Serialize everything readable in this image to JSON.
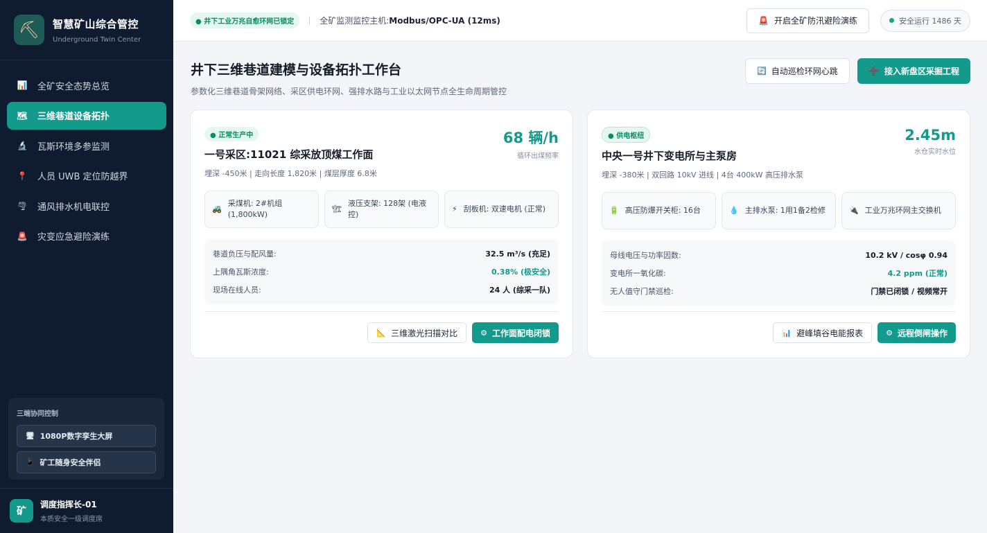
{
  "brand": {
    "title": "智慧矿山综合管控",
    "subtitle": "Underground Twin Center",
    "logo_icon": "⛏"
  },
  "nav": [
    {
      "icon": "📊",
      "icon_name": "chart-icon",
      "label": "全矿安全态势总览",
      "active": false
    },
    {
      "icon": "🗺",
      "icon_name": "map-icon",
      "label": "三维巷道设备拓扑",
      "active": true
    },
    {
      "icon": "🔬",
      "icon_name": "microscope-icon",
      "label": "瓦斯环境多参监测",
      "active": false
    },
    {
      "icon": "📍",
      "icon_name": "pin-icon",
      "label": "人员 UWB 定位防越界",
      "active": false
    },
    {
      "icon": "🌪",
      "icon_name": "ventilation-icon",
      "label": "通风排水机电联控",
      "active": false
    },
    {
      "icon": "🚨",
      "icon_name": "alarm-icon",
      "label": "灾变应急避险演练",
      "active": false
    }
  ],
  "sync": {
    "title": "三端协同控制",
    "buttons": [
      {
        "icon": "🖥",
        "label": "1080P数字孪生大屏"
      },
      {
        "icon": "📱",
        "label": "矿工随身安全伴侣"
      }
    ]
  },
  "user": {
    "avatar": "矿",
    "name": "调度指挥长-01",
    "role": "本质安全一级调度席"
  },
  "topbar": {
    "net_badge": "● 井下工业万兆自愈环网已锁定",
    "monitor_prefix": "全矿监测监控主机:",
    "monitor_value": "Modbus/OPC-UA (12ms)",
    "drill_icon": "🚨",
    "drill_label": "开启全矿防汛避险演练",
    "safe_label": "安全运行 1486 天"
  },
  "header": {
    "title": "井下三维巷道建模与设备拓扑工作台",
    "subtitle": "参数化三维巷道骨架网络、采区供电环网、强排水路与工业以太网节点全生命周期管控",
    "btn_heartbeat": "自动巡检环网心跳",
    "btn_heartbeat_icon": "🔄",
    "btn_add": "接入新盘区采掘工程",
    "btn_add_icon": "➕"
  },
  "cards": [
    {
      "badge": "● 正常生产中",
      "title": "一号采区:11021 综采放顶煤工作面",
      "meta": "埋深 -450米 | 走向长度 1,820米 | 煤层厚度 6.8米",
      "metric_value": "68 辆/h",
      "metric_label": "循环出煤频率",
      "equipment": [
        {
          "icon": "🚜",
          "text": "采煤机: 2#机组 (1,800kW)"
        },
        {
          "icon": "🏗",
          "text": "液压支架: 128架 (电液控)"
        },
        {
          "icon": "⚡",
          "text": "刮板机: 双速电机 (正常)"
        }
      ],
      "stats": [
        {
          "k": "巷道负压与配风量:",
          "v": "32.5 m³/s (充足)",
          "good": false
        },
        {
          "k": "上隅角瓦斯浓度:",
          "v": "0.38% (极安全)",
          "good": true
        },
        {
          "k": "现场在线人员:",
          "v": "24 人 (综采一队)",
          "good": false
        }
      ],
      "foot_outline": "三维激光扫描对比",
      "foot_outline_icon": "📐",
      "foot_primary": "工作面配电闭锁",
      "foot_primary_icon": "⚙"
    },
    {
      "badge": "● 供电枢纽",
      "title": "中央一号井下变电所与主泵房",
      "meta": "埋深 -380米 | 双回路 10kV 进线 | 4台 400kW 高压排水泵",
      "metric_value": "2.45m",
      "metric_label": "水仓实时水位",
      "equipment": [
        {
          "icon": "🔋",
          "text": "高压防爆开关柜: 16台"
        },
        {
          "icon": "💧",
          "text": "主排水泵: 1用1备2检修"
        },
        {
          "icon": "🔌",
          "text": "工业万兆环网主交换机"
        }
      ],
      "stats": [
        {
          "k": "母线电压与功率因数:",
          "v": "10.2 kV / cosφ 0.94",
          "good": false
        },
        {
          "k": "变电所一氧化碳:",
          "v": "4.2 ppm (正常)",
          "good": true
        },
        {
          "k": "无人值守门禁巡检:",
          "v": "门禁已闭锁 / 视频常开",
          "good": false
        }
      ],
      "foot_outline": "避峰填谷电能报表",
      "foot_outline_icon": "📊",
      "foot_primary": "远程倒闸操作",
      "foot_primary_icon": "⚙"
    }
  ]
}
